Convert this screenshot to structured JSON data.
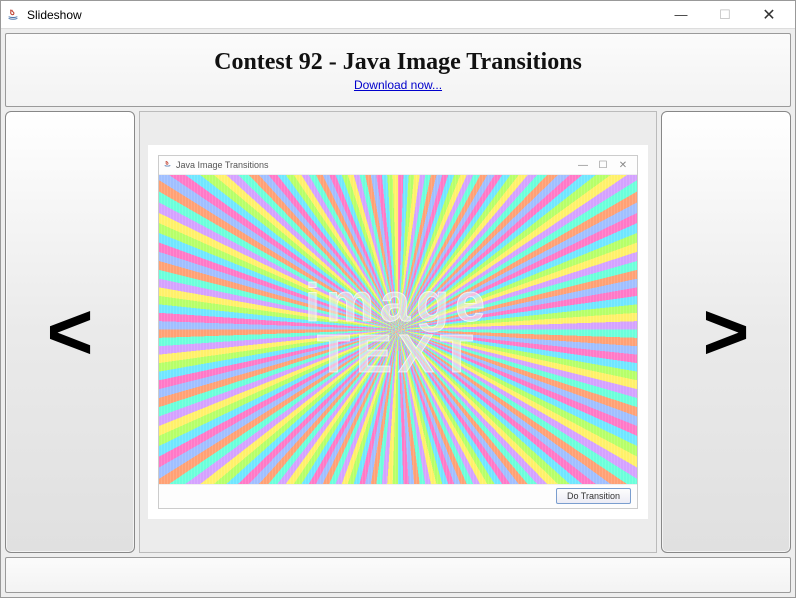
{
  "window": {
    "title": "Slideshow",
    "controls": {
      "minimize": "—",
      "maximize": "☐",
      "close": "✕"
    }
  },
  "header": {
    "title": "Contest 92 - Java Image Transitions",
    "link_text": "Download now..."
  },
  "nav": {
    "prev_glyph": "<",
    "next_glyph": ">"
  },
  "slide": {
    "inner_window_title": "Java Image Transitions",
    "image_text_line1": "image",
    "image_text_line2": "TEXT",
    "do_transition_label": "Do Transition",
    "inner_controls": {
      "minimize": "—",
      "maximize": "☐",
      "close": "✕"
    }
  }
}
